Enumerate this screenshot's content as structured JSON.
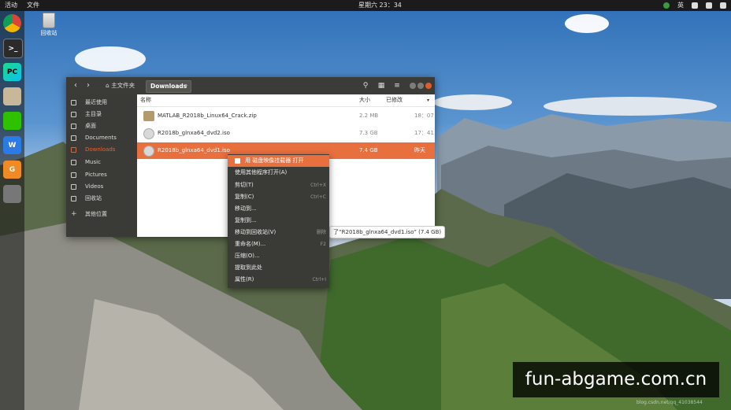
{
  "topbar": {
    "activities": "活动",
    "app_menu": "文件",
    "clock": "星期六 23：34",
    "lang": "英"
  },
  "desktop": {
    "trash_label": "回收站"
  },
  "dock": {
    "items": [
      "chrome-icon",
      "terminal-icon",
      "pycharm-icon",
      "files-icon",
      "wechat-icon",
      "wps-icon",
      "app-icon",
      "camera-icon"
    ]
  },
  "window": {
    "breadcrumb_home": "主文件夹",
    "breadcrumb_current": "Downloads",
    "sidebar": [
      {
        "label": "最近使用",
        "icon": "clock-icon"
      },
      {
        "label": "主目录",
        "icon": "home-icon"
      },
      {
        "label": "桌面",
        "icon": "folder-icon"
      },
      {
        "label": "Documents",
        "icon": "documents-icon"
      },
      {
        "label": "Downloads",
        "icon": "download-icon",
        "active": true
      },
      {
        "label": "Music",
        "icon": "music-icon"
      },
      {
        "label": "Pictures",
        "icon": "pictures-icon"
      },
      {
        "label": "Videos",
        "icon": "videos-icon"
      },
      {
        "label": "回收站",
        "icon": "trash-icon"
      },
      {
        "label": "其他位置",
        "icon": "plus-icon"
      }
    ],
    "columns": {
      "name": "名称",
      "size": "大小",
      "modified": "已修改"
    },
    "files": [
      {
        "name": "MATLAB_R2018b_Linux64_Crack.zip",
        "size": "2.2 MB",
        "modified": "18：07",
        "type": "folder"
      },
      {
        "name": "R2018b_glnxa64_dvd2.iso",
        "size": "7.3 GB",
        "modified": "17：41",
        "type": "disc"
      },
      {
        "name": "R2018b_glnxa64_dvd1.iso",
        "size": "7.4 GB",
        "modified": "昨天",
        "type": "disc",
        "selected": true
      }
    ],
    "status": "了“R2018b_glnxa64_dvd1.iso” (7.4 GB)"
  },
  "context_menu": [
    {
      "label": "用 磁盘映像挂载器 打开",
      "shortcut": "",
      "highlighted": true
    },
    {
      "label": "使用其他程序打开(A)",
      "shortcut": ""
    },
    {
      "label": "剪切(T)",
      "shortcut": "Ctrl+X"
    },
    {
      "label": "复制(C)",
      "shortcut": "Ctrl+C"
    },
    {
      "label": "移动到...",
      "shortcut": ""
    },
    {
      "label": "复制到...",
      "shortcut": ""
    },
    {
      "label": "移动到回收站(V)",
      "shortcut": "删除"
    },
    {
      "label": "重命名(M)...",
      "shortcut": "F2"
    },
    {
      "label": "压缩(O)...",
      "shortcut": ""
    },
    {
      "label": "提取到此处",
      "shortcut": ""
    },
    {
      "label": "属性(R)",
      "shortcut": "Ctrl+I"
    }
  ],
  "watermark": "fun-abgame.com.cn",
  "csdn": "blog.csdn.net/qq_41038544"
}
